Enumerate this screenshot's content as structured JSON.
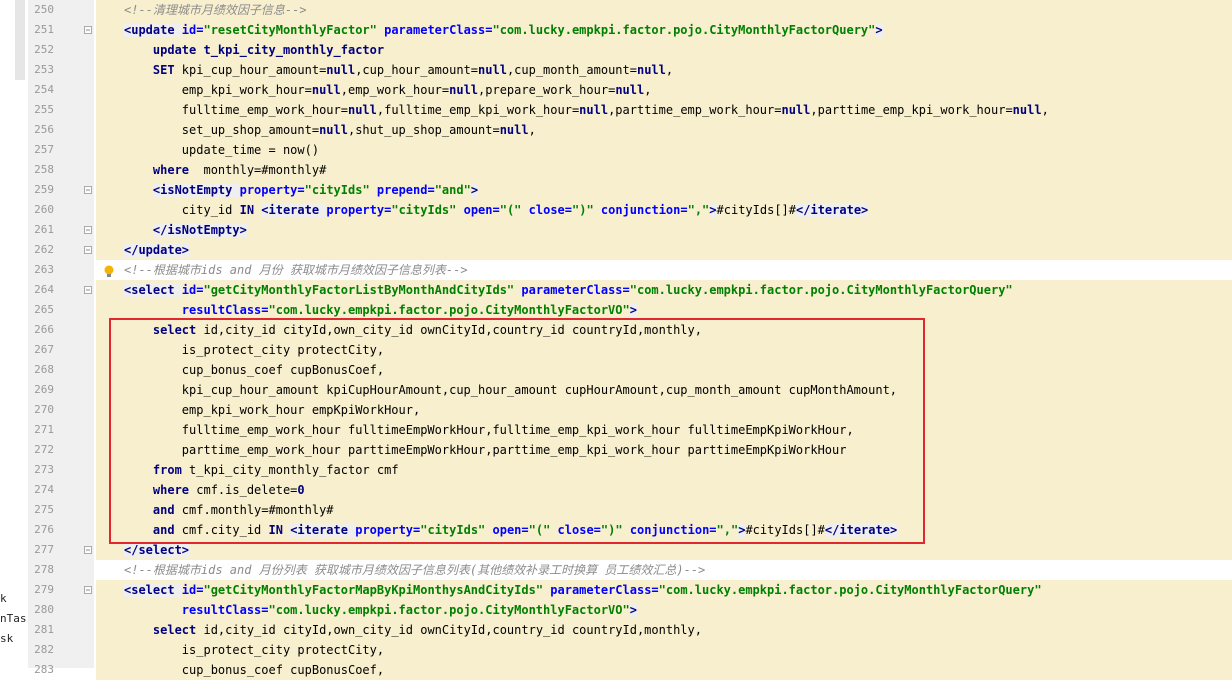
{
  "sidebar": {
    "fragments": [
      "k",
      "nTas",
      "sk"
    ]
  },
  "lines": [
    {
      "n": "250",
      "tokens": [
        {
          "t": "<!--清理城市月绩效因子信息-->",
          "c": "cmt"
        }
      ],
      "bg": "hl"
    },
    {
      "n": "251",
      "tokens": [
        {
          "t": "<update ",
          "c": "tag"
        },
        {
          "t": "id=",
          "c": "attr"
        },
        {
          "t": "\"resetCityMonthlyFactor\"",
          "c": "val"
        },
        {
          "t": " parameterClass=",
          "c": "attr"
        },
        {
          "t": "\"com.lucky.empkpi.factor.pojo.CityMonthlyFactorQuery\"",
          "c": "val"
        },
        {
          "t": ">",
          "c": "tag"
        }
      ],
      "bg": "hl"
    },
    {
      "n": "252",
      "tokens": [
        {
          "t": "    update t_kpi_city_monthly_factor",
          "c": "kw"
        }
      ],
      "bg": "hl"
    },
    {
      "n": "253",
      "tokens": [
        {
          "t": "    SET ",
          "c": "kw"
        },
        {
          "t": "kpi_cup_hour_amount=",
          "c": ""
        },
        {
          "t": "null",
          "c": "nul"
        },
        {
          "t": ",cup_hour_amount=",
          "c": ""
        },
        {
          "t": "null",
          "c": "nul"
        },
        {
          "t": ",cup_month_amount=",
          "c": ""
        },
        {
          "t": "null",
          "c": "nul"
        },
        {
          "t": ",",
          "c": ""
        }
      ],
      "bg": "hl"
    },
    {
      "n": "254",
      "tokens": [
        {
          "t": "        emp_kpi_work_hour=",
          "c": ""
        },
        {
          "t": "null",
          "c": "nul"
        },
        {
          "t": ",emp_work_hour=",
          "c": ""
        },
        {
          "t": "null",
          "c": "nul"
        },
        {
          "t": ",prepare_work_hour=",
          "c": ""
        },
        {
          "t": "null",
          "c": "nul"
        },
        {
          "t": ",",
          "c": ""
        }
      ],
      "bg": "hl"
    },
    {
      "n": "255",
      "tokens": [
        {
          "t": "        fulltime_emp_work_hour=",
          "c": ""
        },
        {
          "t": "null",
          "c": "nul"
        },
        {
          "t": ",fulltime_emp_kpi_work_hour=",
          "c": ""
        },
        {
          "t": "null",
          "c": "nul"
        },
        {
          "t": ",parttime_emp_work_hour=",
          "c": ""
        },
        {
          "t": "null",
          "c": "nul"
        },
        {
          "t": ",parttime_emp_kpi_work_hour=",
          "c": ""
        },
        {
          "t": "null",
          "c": "nul"
        },
        {
          "t": ",",
          "c": ""
        }
      ],
      "bg": "hl"
    },
    {
      "n": "256",
      "tokens": [
        {
          "t": "        set_up_shop_amount=",
          "c": ""
        },
        {
          "t": "null",
          "c": "nul"
        },
        {
          "t": ",shut_up_shop_amount=",
          "c": ""
        },
        {
          "t": "null",
          "c": "nul"
        },
        {
          "t": ",",
          "c": ""
        }
      ],
      "bg": "hl"
    },
    {
      "n": "257",
      "tokens": [
        {
          "t": "        update_time = now()",
          "c": ""
        }
      ],
      "bg": "hl"
    },
    {
      "n": "258",
      "tokens": [
        {
          "t": "    where  ",
          "c": "kw"
        },
        {
          "t": "monthly=#monthly#",
          "c": ""
        }
      ],
      "bg": "hl"
    },
    {
      "n": "259",
      "tokens": [
        {
          "t": "    ",
          "c": ""
        },
        {
          "t": "<isNotEmpty ",
          "c": "tag"
        },
        {
          "t": "property=",
          "c": "attr"
        },
        {
          "t": "\"cityIds\"",
          "c": "val"
        },
        {
          "t": " prepend=",
          "c": "attr"
        },
        {
          "t": "\"and\"",
          "c": "val"
        },
        {
          "t": ">",
          "c": "tag"
        }
      ],
      "bg": "hl"
    },
    {
      "n": "260",
      "tokens": [
        {
          "t": "        city_id ",
          "c": ""
        },
        {
          "t": "IN ",
          "c": "kw"
        },
        {
          "t": "<iterate ",
          "c": "tag"
        },
        {
          "t": "property=",
          "c": "attr"
        },
        {
          "t": "\"cityIds\"",
          "c": "val"
        },
        {
          "t": " open=",
          "c": "attr"
        },
        {
          "t": "\"(\"",
          "c": "val"
        },
        {
          "t": " close=",
          "c": "attr"
        },
        {
          "t": "\")\"",
          "c": "val"
        },
        {
          "t": " conjunction=",
          "c": "attr"
        },
        {
          "t": "\",\"",
          "c": "val"
        },
        {
          "t": ">",
          "c": "tag"
        },
        {
          "t": "#cityIds[]#",
          "c": ""
        },
        {
          "t": "</iterate>",
          "c": "tag"
        }
      ],
      "bg": "hl"
    },
    {
      "n": "261",
      "tokens": [
        {
          "t": "    ",
          "c": ""
        },
        {
          "t": "</isNotEmpty>",
          "c": "tag"
        }
      ],
      "bg": "hl"
    },
    {
      "n": "262",
      "tokens": [
        {
          "t": "</update>",
          "c": "tag"
        }
      ],
      "bg": "hl"
    },
    {
      "n": "263",
      "tokens": [
        {
          "t": "<!--根据城市ids and 月份 获取城市月绩效因子信息列表-->",
          "c": "cmt"
        }
      ],
      "bg": ""
    },
    {
      "n": "264",
      "tokens": [
        {
          "t": "<select ",
          "c": "tag"
        },
        {
          "t": "id=",
          "c": "attr"
        },
        {
          "t": "\"getCityMonthlyFactorListByMonthAndCityIds\"",
          "c": "val"
        },
        {
          "t": " parameterClass=",
          "c": "attr"
        },
        {
          "t": "\"com.lucky.empkpi.factor.pojo.CityMonthlyFactorQuery\"",
          "c": "val"
        }
      ],
      "bg": "hl"
    },
    {
      "n": "265",
      "tokens": [
        {
          "t": "        resultClass=",
          "c": "attr"
        },
        {
          "t": "\"com.lucky.empkpi.factor.pojo.CityMonthlyFactorVO\"",
          "c": "val"
        },
        {
          "t": ">",
          "c": "tag"
        }
      ],
      "bg": "hl"
    },
    {
      "n": "266",
      "tokens": [
        {
          "t": "    select ",
          "c": "kw"
        },
        {
          "t": "id,city_id cityId,own_city_id ownCityId,country_id countryId,monthly,",
          "c": ""
        }
      ],
      "bg": "hl"
    },
    {
      "n": "267",
      "tokens": [
        {
          "t": "        is_protect_city protectCity,",
          "c": ""
        }
      ],
      "bg": "hl"
    },
    {
      "n": "268",
      "tokens": [
        {
          "t": "        cup_bonus_coef cupBonusCoef,",
          "c": ""
        }
      ],
      "bg": "hl"
    },
    {
      "n": "269",
      "tokens": [
        {
          "t": "        kpi_cup_hour_amount kpiCupHourAmount,cup_hour_amount cupHourAmount,cup_month_amount cupMonthAmount,",
          "c": ""
        }
      ],
      "bg": "hl"
    },
    {
      "n": "270",
      "tokens": [
        {
          "t": "        emp_kpi_work_hour empKpiWorkHour,",
          "c": ""
        }
      ],
      "bg": "hl"
    },
    {
      "n": "271",
      "tokens": [
        {
          "t": "        fulltime_emp_work_hour fulltimeEmpWorkHour,fulltime_emp_kpi_work_hour fulltimeEmpKpiWorkHour,",
          "c": ""
        }
      ],
      "bg": "hl"
    },
    {
      "n": "272",
      "tokens": [
        {
          "t": "        parttime_emp_work_hour parttimeEmpWorkHour,parttime_emp_kpi_work_hour parttimeEmpKpiWorkHour",
          "c": ""
        }
      ],
      "bg": "hl"
    },
    {
      "n": "273",
      "tokens": [
        {
          "t": "    from ",
          "c": "kw"
        },
        {
          "t": "t_kpi_city_monthly_factor cmf",
          "c": ""
        }
      ],
      "bg": "hl"
    },
    {
      "n": "274",
      "tokens": [
        {
          "t": "    where ",
          "c": "kw"
        },
        {
          "t": "cmf.is_delete=",
          "c": ""
        },
        {
          "t": "0",
          "c": "nul"
        }
      ],
      "bg": "hl"
    },
    {
      "n": "275",
      "tokens": [
        {
          "t": "    and ",
          "c": "kw"
        },
        {
          "t": "cmf.monthly=#monthly#",
          "c": ""
        }
      ],
      "bg": "hl"
    },
    {
      "n": "276",
      "tokens": [
        {
          "t": "    and ",
          "c": "kw"
        },
        {
          "t": "cmf.city_id ",
          "c": ""
        },
        {
          "t": "IN ",
          "c": "kw"
        },
        {
          "t": "<iterate ",
          "c": "tag"
        },
        {
          "t": "property=",
          "c": "attr"
        },
        {
          "t": "\"cityIds\"",
          "c": "val"
        },
        {
          "t": " open=",
          "c": "attr"
        },
        {
          "t": "\"(\"",
          "c": "val"
        },
        {
          "t": " close=",
          "c": "attr"
        },
        {
          "t": "\")\"",
          "c": "val"
        },
        {
          "t": " conjunction=",
          "c": "attr"
        },
        {
          "t": "\",\"",
          "c": "val"
        },
        {
          "t": ">",
          "c": "tag"
        },
        {
          "t": "#cityIds[]#",
          "c": ""
        },
        {
          "t": "</iterate>",
          "c": "tag"
        }
      ],
      "bg": "hl"
    },
    {
      "n": "277",
      "tokens": [
        {
          "t": "</select>",
          "c": "tag"
        }
      ],
      "bg": "hl"
    },
    {
      "n": "278",
      "tokens": [
        {
          "t": "<!--根据城市ids and 月份列表 获取城市月绩效因子信息列表(其他绩效补录工时换算 员工绩效汇总)-->",
          "c": "cmt"
        }
      ],
      "bg": ""
    },
    {
      "n": "279",
      "tokens": [
        {
          "t": "<select ",
          "c": "tag"
        },
        {
          "t": "id=",
          "c": "attr"
        },
        {
          "t": "\"getCityMonthlyFactorMapByKpiMonthysAndCityIds\"",
          "c": "val"
        },
        {
          "t": " parameterClass=",
          "c": "attr"
        },
        {
          "t": "\"com.lucky.empkpi.factor.pojo.CityMonthlyFactorQuery\"",
          "c": "val"
        }
      ],
      "bg": "hl"
    },
    {
      "n": "280",
      "tokens": [
        {
          "t": "        resultClass=",
          "c": "attr"
        },
        {
          "t": "\"com.lucky.empkpi.factor.pojo.CityMonthlyFactorVO\"",
          "c": "val"
        },
        {
          "t": ">",
          "c": "tag"
        }
      ],
      "bg": "hl"
    },
    {
      "n": "281",
      "tokens": [
        {
          "t": "    select ",
          "c": "kw"
        },
        {
          "t": "id,city_id cityId,own_city_id ownCityId,country_id countryId,monthly,",
          "c": ""
        }
      ],
      "bg": "hl"
    },
    {
      "n": "282",
      "tokens": [
        {
          "t": "        is_protect_city protectCity,",
          "c": ""
        }
      ],
      "bg": "hl"
    },
    {
      "n": "283",
      "tokens": [
        {
          "t": "        cup_bonus_coef cupBonusCoef,",
          "c": ""
        }
      ],
      "bg": "hl"
    }
  ],
  "colors": {
    "highlight_box": "#e0282e",
    "line_bg": "#f8efce"
  }
}
